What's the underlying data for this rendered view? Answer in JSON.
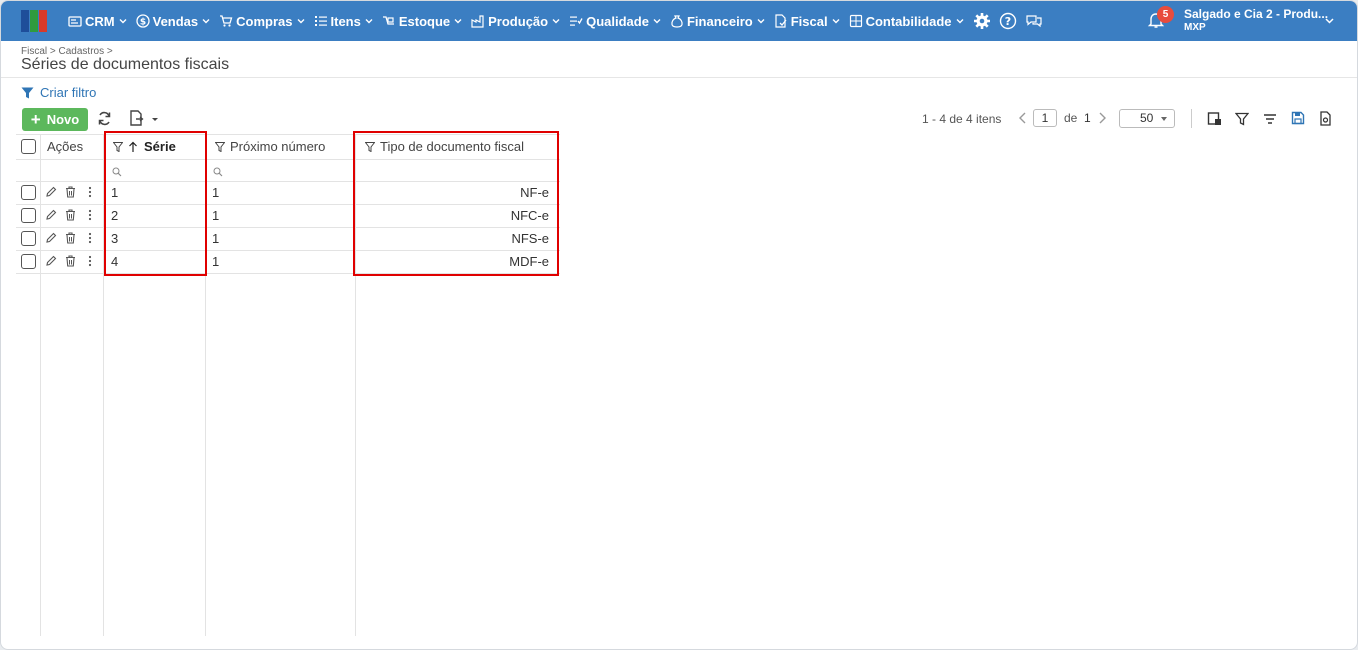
{
  "nav": {
    "items": [
      {
        "label": "CRM",
        "icon": "crm-icon"
      },
      {
        "label": "Vendas",
        "icon": "dollar-icon"
      },
      {
        "label": "Compras",
        "icon": "cart-icon"
      },
      {
        "label": "Itens",
        "icon": "items-icon"
      },
      {
        "label": "Estoque",
        "icon": "stock-icon"
      },
      {
        "label": "Produção",
        "icon": "factory-icon"
      },
      {
        "label": "Qualidade",
        "icon": "quality-icon"
      },
      {
        "label": "Financeiro",
        "icon": "money-bag-icon"
      },
      {
        "label": "Fiscal",
        "icon": "fiscal-icon"
      },
      {
        "label": "Contabilidade",
        "icon": "calculator-icon"
      }
    ],
    "notifications": "5",
    "company": "Salgado e Cia 2 - Produ...",
    "company_sub": "MXP"
  },
  "page": {
    "breadcrumb": "Fiscal > Cadastros >",
    "title": "Séries de documentos fiscais",
    "create_filter": "Criar filtro"
  },
  "toolbar": {
    "new_label": "Novo",
    "pager_info": "1 - 4 de 4 itens",
    "page": "1",
    "of": "de",
    "total_pages": "1",
    "page_size": "50"
  },
  "grid": {
    "headers": {
      "actions": "Ações",
      "serie": "Série",
      "proximo": "Próximo número",
      "tipo": "Tipo de documento fiscal"
    },
    "rows": [
      {
        "serie": "1",
        "proximo": "1",
        "tipo": "NF-e"
      },
      {
        "serie": "2",
        "proximo": "1",
        "tipo": "NFC-e"
      },
      {
        "serie": "3",
        "proximo": "1",
        "tipo": "NFS-e"
      },
      {
        "serie": "4",
        "proximo": "1",
        "tipo": "MDF-e"
      }
    ]
  },
  "colors": {
    "topbar": "#3b7ec2",
    "new_button": "#5cb85c",
    "highlight": "#e00000",
    "link": "#2f75b5",
    "badge": "#e84c3d"
  }
}
